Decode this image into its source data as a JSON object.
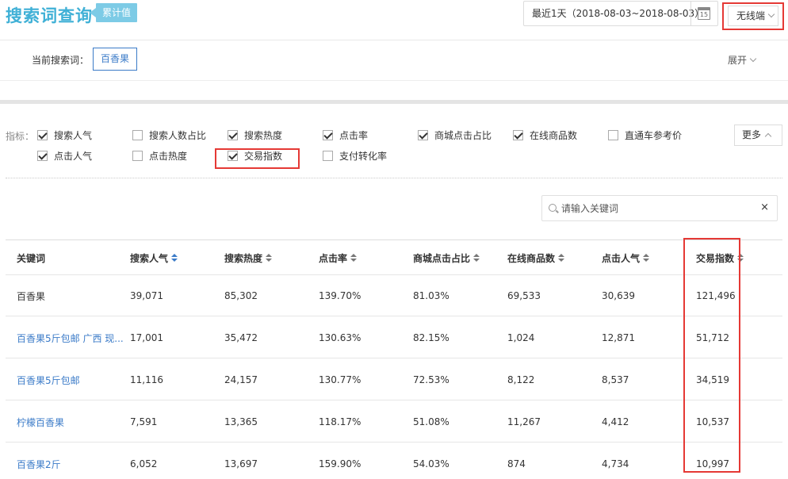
{
  "header": {
    "title": "搜索词查询",
    "badge": "累计值",
    "date_range": "最近1天（2018-08-03~2018-08-03）",
    "calendar_day": "15",
    "device": "无线端"
  },
  "filter": {
    "current_label": "当前搜索词：",
    "current_keyword": "百香果",
    "expand_label": "展开"
  },
  "indicators": {
    "label": "指标：",
    "more_label": "更多",
    "items": [
      {
        "label": "搜索人气",
        "checked": true
      },
      {
        "label": "搜索人数占比",
        "checked": false
      },
      {
        "label": "搜索热度",
        "checked": true
      },
      {
        "label": "点击率",
        "checked": true
      },
      {
        "label": "商城点击占比",
        "checked": true
      },
      {
        "label": "在线商品数",
        "checked": true
      },
      {
        "label": "直通车参考价",
        "checked": false
      },
      {
        "label": "点击人气",
        "checked": true
      },
      {
        "label": "点击热度",
        "checked": false
      },
      {
        "label": "交易指数",
        "checked": true
      },
      {
        "label": "支付转化率",
        "checked": false
      }
    ]
  },
  "search": {
    "placeholder": "请输入关键词",
    "clear": "×"
  },
  "table": {
    "headers": [
      "关键词",
      "搜索人气",
      "搜索热度",
      "点击率",
      "商城点击占比",
      "在线商品数",
      "点击人气",
      "交易指数"
    ],
    "rows": [
      [
        "百香果",
        "39,071",
        "85,302",
        "139.70%",
        "81.03%",
        "69,533",
        "30,639",
        "121,496"
      ],
      [
        "百香果5斤包邮 广西 现...",
        "17,001",
        "35,472",
        "130.63%",
        "82.15%",
        "1,024",
        "12,871",
        "51,712"
      ],
      [
        "百香果5斤包邮",
        "11,116",
        "24,157",
        "130.77%",
        "72.53%",
        "8,122",
        "8,537",
        "34,519"
      ],
      [
        "柠檬百香果",
        "7,591",
        "13,365",
        "118.17%",
        "51.08%",
        "11,267",
        "4,412",
        "10,537"
      ],
      [
        "百香果2斤",
        "6,052",
        "13,697",
        "159.90%",
        "54.03%",
        "874",
        "4,734",
        "10,997"
      ]
    ]
  },
  "colors": {
    "accent": "#3fb0d6",
    "badge": "#7dcbe6",
    "link": "#3b7bc8",
    "highlight_frame": "#e53935"
  }
}
